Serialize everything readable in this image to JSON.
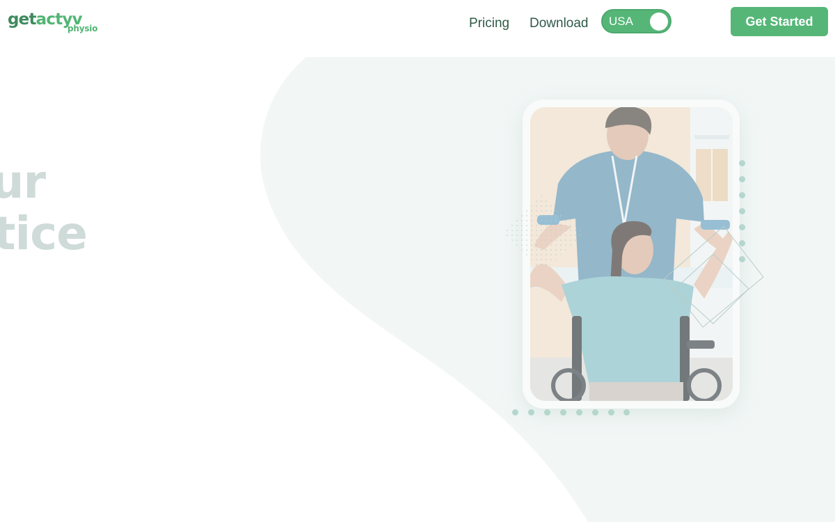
{
  "brand": {
    "logo_part1": "get",
    "logo_part2": "actyv",
    "logo_sub": "physio"
  },
  "nav": {
    "links": [
      {
        "label": "Pricing"
      },
      {
        "label": "Download"
      }
    ],
    "region_toggle": {
      "label": "USA",
      "state": "on"
    },
    "cta_label": "Get Started"
  },
  "hero": {
    "line1": "ur",
    "line2": "tice",
    "image_alt": "Physiotherapist assisting a woman in a wheelchair lifting dumbbells"
  },
  "colors": {
    "brand_green": "#55b677",
    "brand_dark_green": "#3f8a5e",
    "nav_text": "#2f5a48",
    "hero_text": "#cfdbd8",
    "bg_tint": "#f2f7f6",
    "dot_color": "#b5d6cc"
  }
}
